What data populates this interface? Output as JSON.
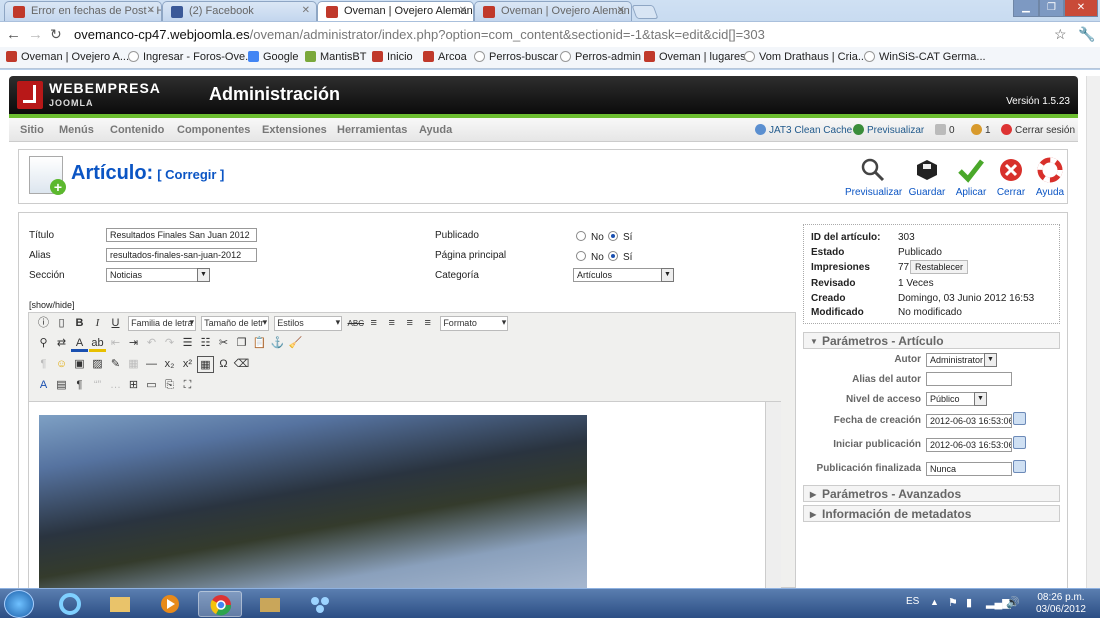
{
  "browser": {
    "tabs": [
      {
        "label": "Error en fechas de Post - Hc",
        "color": "#c0392b"
      },
      {
        "label": "(2) Facebook",
        "color": "#3b5998"
      },
      {
        "label": "Oveman | Ovejero Aleman",
        "color": "#c0392b"
      },
      {
        "label": "Oveman | Ovejero Aleman",
        "color": "#c0392b"
      }
    ],
    "url_host": "ovemanco-cp47.webjoomla.es",
    "url_path": "/oveman/administrator/index.php?option=com_content&sectionid=-1&task=edit&cid[]=303",
    "bookmarks": [
      "Oveman | Ovejero A...",
      "Ingresar - Foros-Ove...",
      "Google",
      "MantisBT",
      "Inicio",
      "Arcoa",
      "Perros-buscar",
      "Perros-admin",
      "Oveman | lugares",
      "Vom Drathaus | Cria...",
      "WinSiS-CAT Germa..."
    ]
  },
  "header": {
    "brand": "WEBEMPRESA",
    "brand_sub": "JOOMLA",
    "title": "Administración",
    "version": "Versión 1.5.23"
  },
  "menu": {
    "items": [
      "Sitio",
      "Menús",
      "Contenido",
      "Componentes",
      "Extensiones",
      "Herramientas",
      "Ayuda"
    ],
    "cache": "JAT3 Clean Cache",
    "preview": "Previsualizar",
    "count1": "0",
    "count2": "1",
    "logout": "Cerrar sesión"
  },
  "toolbar": {
    "title": "Artículo:",
    "subtitle": "[ Corregir ]",
    "buttons": [
      "Previsualizar",
      "Guardar",
      "Aplicar",
      "Cerrar",
      "Ayuda"
    ]
  },
  "form": {
    "titulo_label": "Título",
    "titulo_value": "Resultados Finales San Juan 2012",
    "alias_label": "Alias",
    "alias_value": "resultados-finales-san-juan-2012",
    "seccion_label": "Sección",
    "seccion_value": "Noticias",
    "publicado_label": "Publicado",
    "pagina_label": "Página principal",
    "no": "No",
    "si": "Sí",
    "categoria_label": "Categoría",
    "categoria_value": "Artículos",
    "showhide": "[show/hide]"
  },
  "editor": {
    "font_family": "Familia de letra",
    "font_size": "Tamaño de letr",
    "styles": "Estilos",
    "format": "Formato"
  },
  "info": {
    "rows": [
      {
        "k": "ID del artículo:",
        "v": "303"
      },
      {
        "k": "Estado",
        "v": "Publicado"
      },
      {
        "k": "Impresiones",
        "v": "77"
      },
      {
        "k": "Revisado",
        "v": "1 Veces"
      },
      {
        "k": "Creado",
        "v": "Domingo, 03 Junio 2012 16:53"
      },
      {
        "k": "Modificado",
        "v": "No modificado"
      }
    ],
    "reset": "Restablecer"
  },
  "params": {
    "title": "Parámetros - Artículo",
    "autor_label": "Autor",
    "autor_value": "Administrator",
    "alias_autor_label": "Alias del autor",
    "alias_autor_value": "",
    "nivel_label": "Nivel de acceso",
    "nivel_value": "Público",
    "creacion_label": "Fecha de creación",
    "creacion_value": "2012-06-03 16:53:06",
    "inicio_label": "Iniciar publicación",
    "inicio_value": "2012-06-03 16:53:06",
    "fin_label": "Publicación finalizada",
    "fin_value": "Nunca",
    "avanzados": "Parámetros - Avanzados",
    "metadatos": "Información de metadatos"
  },
  "taskbar": {
    "lang": "ES",
    "time": "08:26 p.m.",
    "date": "03/06/2012"
  }
}
